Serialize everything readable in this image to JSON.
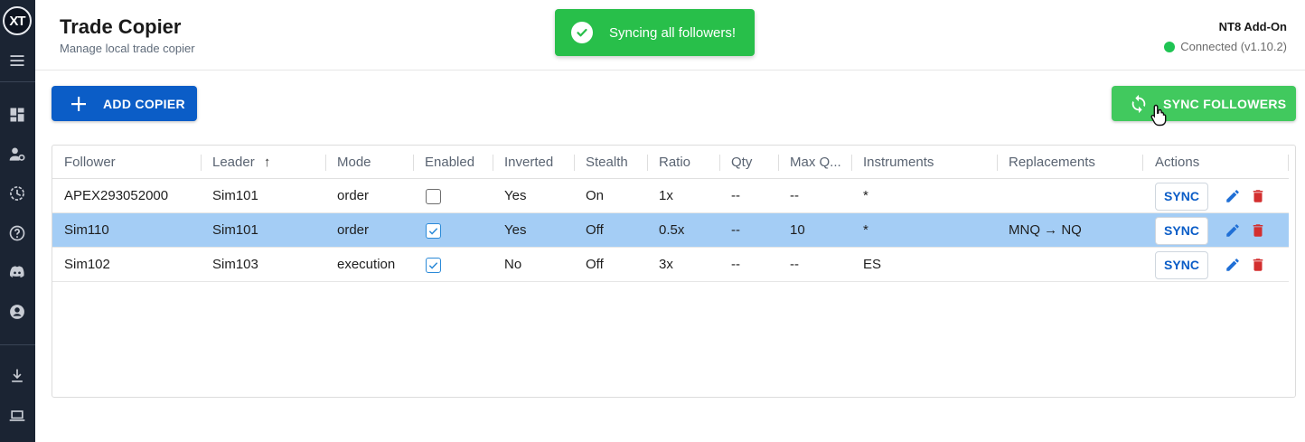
{
  "app": {
    "logo_text": "XT",
    "title": "Trade Copier",
    "subtitle": "Manage local trade copier",
    "addon_label": "NT8 Add-On",
    "connection_status": "Connected (v1.10.2)",
    "connection_color": "#1fc453"
  },
  "sidebar": {
    "items": [
      {
        "icon": "menu-icon"
      },
      {
        "icon": "dashboard-icon"
      },
      {
        "icon": "users-settings-icon"
      },
      {
        "icon": "history-icon"
      },
      {
        "icon": "help-icon"
      },
      {
        "icon": "discord-icon"
      },
      {
        "icon": "account-icon"
      },
      {
        "icon": "download-icon"
      },
      {
        "icon": "laptop-icon"
      }
    ]
  },
  "toast": {
    "message": "Syncing all followers!",
    "color": "#28bf4a"
  },
  "toolbar": {
    "add_label": "ADD COPIER",
    "sync_all_label": "SYNC FOLLOWERS"
  },
  "table": {
    "columns": {
      "follower": "Follower",
      "leader": "Leader",
      "leader_sort": "↑",
      "mode": "Mode",
      "enabled": "Enabled",
      "inverted": "Inverted",
      "stealth": "Stealth",
      "ratio": "Ratio",
      "qty": "Qty",
      "maxq": "Max Q...",
      "instruments": "Instruments",
      "replacements": "Replacements",
      "actions": "Actions"
    },
    "rows": [
      {
        "follower": "APEX293052000",
        "leader": "Sim101",
        "mode": "order",
        "enabled": false,
        "inverted": "Yes",
        "stealth": "On",
        "ratio": "1x",
        "qty": "--",
        "maxq": "--",
        "instruments": "*",
        "replacements": "",
        "sync_label": "SYNC",
        "selected": false
      },
      {
        "follower": "Sim110",
        "leader": "Sim101",
        "mode": "order",
        "enabled": true,
        "inverted": "Yes",
        "stealth": "Off",
        "ratio": "0.5x",
        "qty": "--",
        "maxq": "10",
        "instruments": "*",
        "replacements": "MNQ → NQ",
        "sync_label": "SYNC",
        "selected": true
      },
      {
        "follower": "Sim102",
        "leader": "Sim103",
        "mode": "execution",
        "enabled": true,
        "inverted": "No",
        "stealth": "Off",
        "ratio": "3x",
        "qty": "--",
        "maxq": "--",
        "instruments": "ES",
        "replacements": "",
        "sync_label": "SYNC",
        "selected": false
      }
    ]
  },
  "colors": {
    "primary": "#0b5dc7",
    "success": "#41c95e",
    "danger": "#d32f2f",
    "edit": "#1f6fd6",
    "selected_row": "#a4cdf5"
  }
}
